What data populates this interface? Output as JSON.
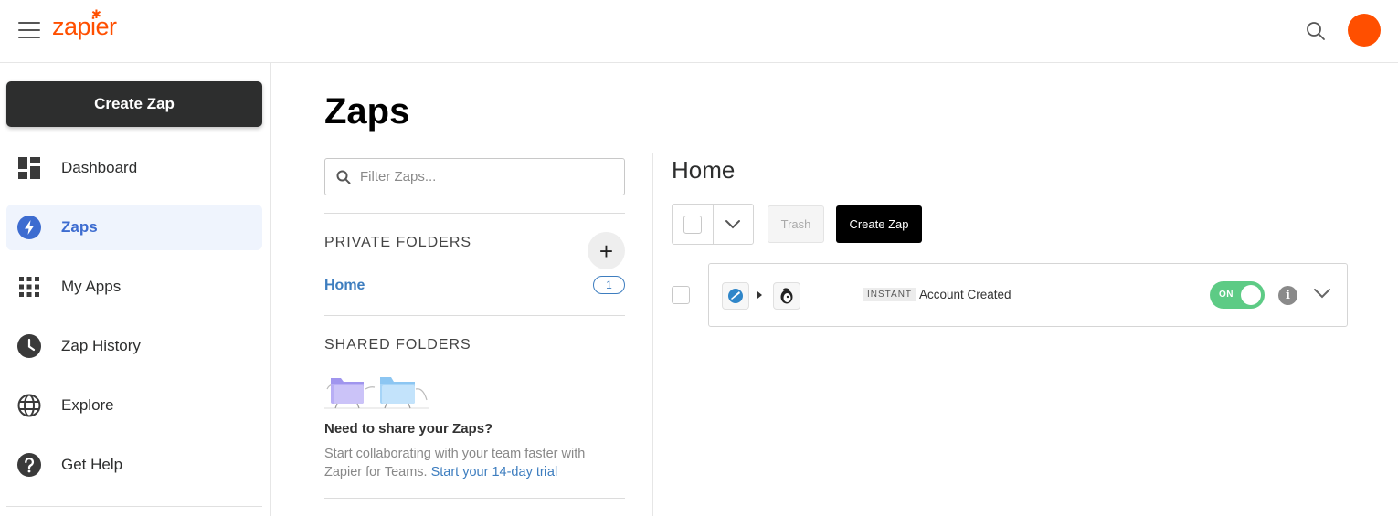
{
  "topbar": {
    "logo_text": "zapier",
    "icons": {
      "menu": "hamburger-icon",
      "search": "search-icon"
    },
    "avatar_color": "#ff4f00"
  },
  "sidebar": {
    "create_button": "Create Zap",
    "items": [
      {
        "label": "Dashboard",
        "icon": "dashboard-icon",
        "active": false
      },
      {
        "label": "Zaps",
        "icon": "lightning-bolt-icon",
        "active": true
      },
      {
        "label": "My Apps",
        "icon": "grid-icon",
        "active": false
      },
      {
        "label": "Zap History",
        "icon": "clock-icon",
        "active": false
      },
      {
        "label": "Explore",
        "icon": "globe-icon",
        "active": false
      },
      {
        "label": "Get Help",
        "icon": "question-icon",
        "active": false
      }
    ]
  },
  "main": {
    "title": "Zaps",
    "filter": {
      "placeholder": "Filter Zaps...",
      "value": ""
    },
    "private_folders": {
      "heading": "PRIVATE FOLDERS",
      "add_label": "+",
      "folders": [
        {
          "name": "Home",
          "count": "1"
        }
      ]
    },
    "shared_folders": {
      "heading": "SHARED FOLDERS",
      "prompt_heading": "Need to share your Zaps?",
      "prompt_text": "Start collaborating with your team faster with Zapier for Teams.",
      "prompt_link": "Start your 14-day trial"
    },
    "folder_view": {
      "title": "Home",
      "trash_label": "Trash",
      "create_label": "Create Zap",
      "zaps": [
        {
          "badge": "INSTANT",
          "name": "Account Created",
          "status": "ON",
          "apps": [
            "trigger-app-icon",
            "mailchimp-icon"
          ]
        }
      ]
    }
  },
  "colors": {
    "brand": "#ff4f00",
    "active_nav": "#3d6cd0",
    "link": "#3d7dbf",
    "toggle_on": "#5dcb85"
  }
}
